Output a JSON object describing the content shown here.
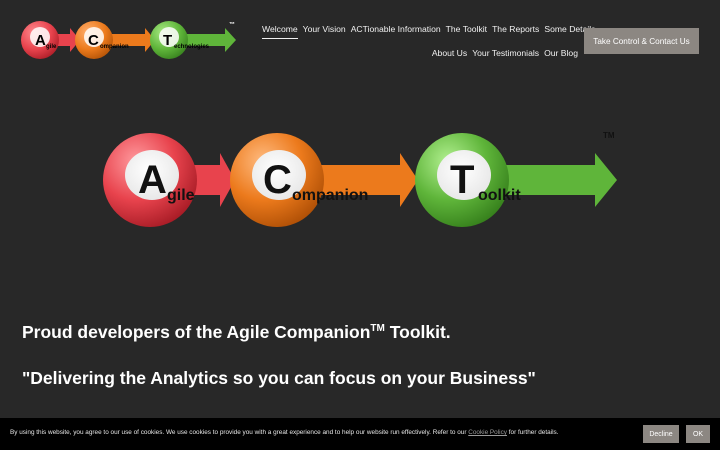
{
  "brand": {
    "small_logo": {
      "letters": [
        "A",
        "C",
        "T"
      ],
      "words": [
        "gile",
        "ompanion",
        "echnologies"
      ],
      "tm": "™"
    },
    "hero_logo": {
      "letters": [
        "A",
        "C",
        "T"
      ],
      "words": [
        "gile",
        "ompanion",
        "oolkit"
      ],
      "tm": "TM"
    },
    "colors": {
      "red": "#e8434d",
      "orange": "#ec7a1c",
      "green": "#5fb53a"
    }
  },
  "nav": {
    "row1": [
      "Welcome",
      "Your Vision",
      "ACTionable Information",
      "The Toolkit",
      "The Reports",
      "Some Details"
    ],
    "row2": [
      "About Us",
      "Your Testimonials",
      "Our Blog"
    ],
    "active": "Welcome",
    "cta_label": "Take Control & Contact Us"
  },
  "main": {
    "headline1_pre": "Proud developers of the Agile Companion",
    "headline1_tm": "TM",
    "headline1_post": " Toolkit.",
    "headline2": "\"Delivering the Analytics so you can focus on your Business\""
  },
  "cookie": {
    "text_pre": "By using this website, you agree to our use of cookies. We use cookies to provide you with a great experience and to help our website run effectively. Refer to our ",
    "link": "Cookie Policy",
    "text_post": " for further details.",
    "decline_label": "Decline",
    "ok_label": "OK"
  }
}
